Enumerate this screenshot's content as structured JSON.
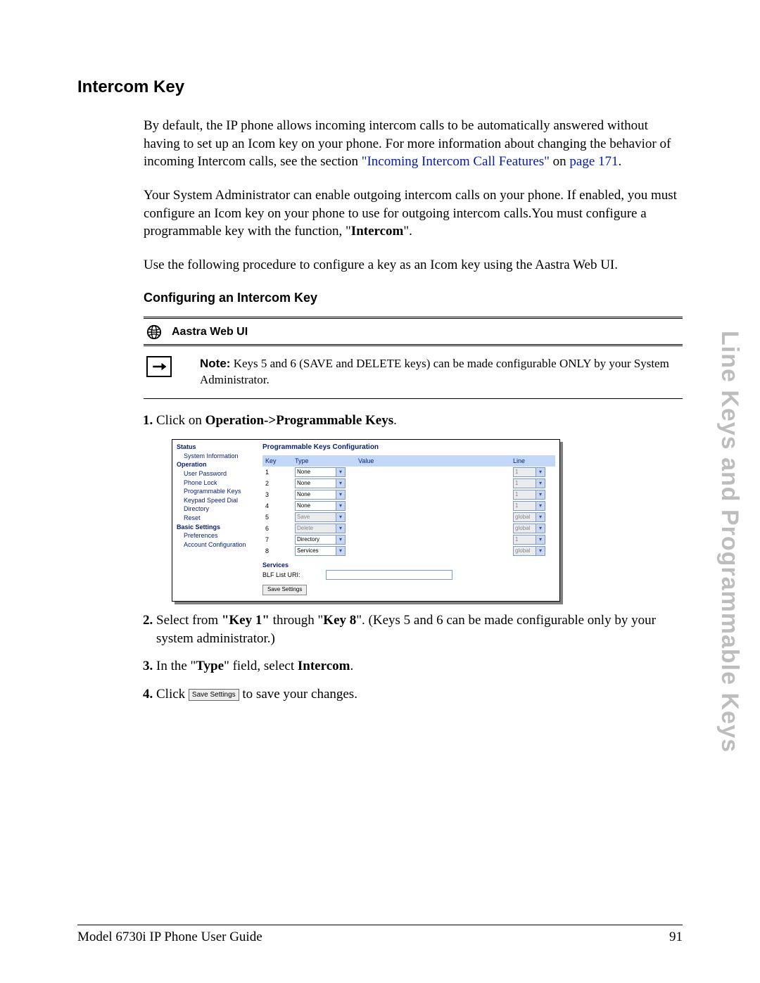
{
  "heading": "Intercom Key",
  "para1_a": "By default, the IP phone allows incoming intercom calls to be automatically answered without having to set up an Icom key on your phone. For more information about changing the behavior of incoming Intercom calls, see the section ",
  "link1": "\"Incoming Intercom Call Features\"",
  "para1_b": " on ",
  "link2": "page 171",
  "para1_c": ".",
  "para2_a": "Your System Administrator can enable outgoing intercom calls on your phone. If enabled, you must configure an Icom key on your phone to use for outgoing intercom calls.You must configure a programmable key with the function, \"",
  "para2_bold": "Intercom",
  "para2_b": "\".",
  "para3": "Use the following procedure to configure a key as an Icom key using the Aastra Web UI.",
  "subhead": "Configuring an Intercom Key",
  "aastra_label": "Aastra Web UI",
  "note_label": "Note:",
  "note_text": " Keys 5 and 6 (SAVE and DELETE keys) can be made configurable ONLY by your System Administrator.",
  "step1_a": "Click on ",
  "step1_b": "Operation->Programmable Keys",
  "step1_c": ".",
  "step2_a": "Select from ",
  "step2_b": "\"Key 1\"",
  "step2_c": " through \"",
  "step2_d": "Key 8",
  "step2_e": "\". (Keys 5 and 6 can be made configurable only by your system administrator.)",
  "step3_a": "In the \"",
  "step3_b": "Type",
  "step3_c": "\" field, select ",
  "step3_d": "Intercom",
  "step3_e": ".",
  "step4_a": "Click ",
  "step4_btn": "Save Settings",
  "step4_b": " to save your changes.",
  "ui": {
    "sidebar": {
      "status": "Status",
      "sysinfo": "System Information",
      "operation": "Operation",
      "items_op": [
        "User Password",
        "Phone Lock",
        "Programmable Keys",
        "Keypad Speed Dial",
        "Directory",
        "Reset"
      ],
      "basic": "Basic Settings",
      "items_basic": [
        "Preferences",
        "Account Configuration"
      ]
    },
    "title": "Programmable Keys Configuration",
    "headers": {
      "key": "Key",
      "type": "Type",
      "value": "Value",
      "line": "Line"
    },
    "rows": [
      {
        "k": "1",
        "type": "None",
        "line": "1",
        "en": true,
        "lineEn": false
      },
      {
        "k": "2",
        "type": "None",
        "line": "1",
        "en": true,
        "lineEn": false
      },
      {
        "k": "3",
        "type": "None",
        "line": "1",
        "en": true,
        "lineEn": false
      },
      {
        "k": "4",
        "type": "None",
        "line": "1",
        "en": true,
        "lineEn": false
      },
      {
        "k": "5",
        "type": "Save",
        "line": "global",
        "en": false,
        "lineEn": false
      },
      {
        "k": "6",
        "type": "Delete",
        "line": "global",
        "en": false,
        "lineEn": false
      },
      {
        "k": "7",
        "type": "Directory",
        "line": "1",
        "en": true,
        "lineEn": false
      },
      {
        "k": "8",
        "type": "Services",
        "line": "global",
        "en": true,
        "lineEn": false
      }
    ],
    "services": "Services",
    "blf": "BLF List URI:",
    "save": "Save Settings"
  },
  "side_tab": "Line Keys and Programmable Keys",
  "footer_left": "Model 6730i IP Phone User Guide",
  "footer_right": "91"
}
